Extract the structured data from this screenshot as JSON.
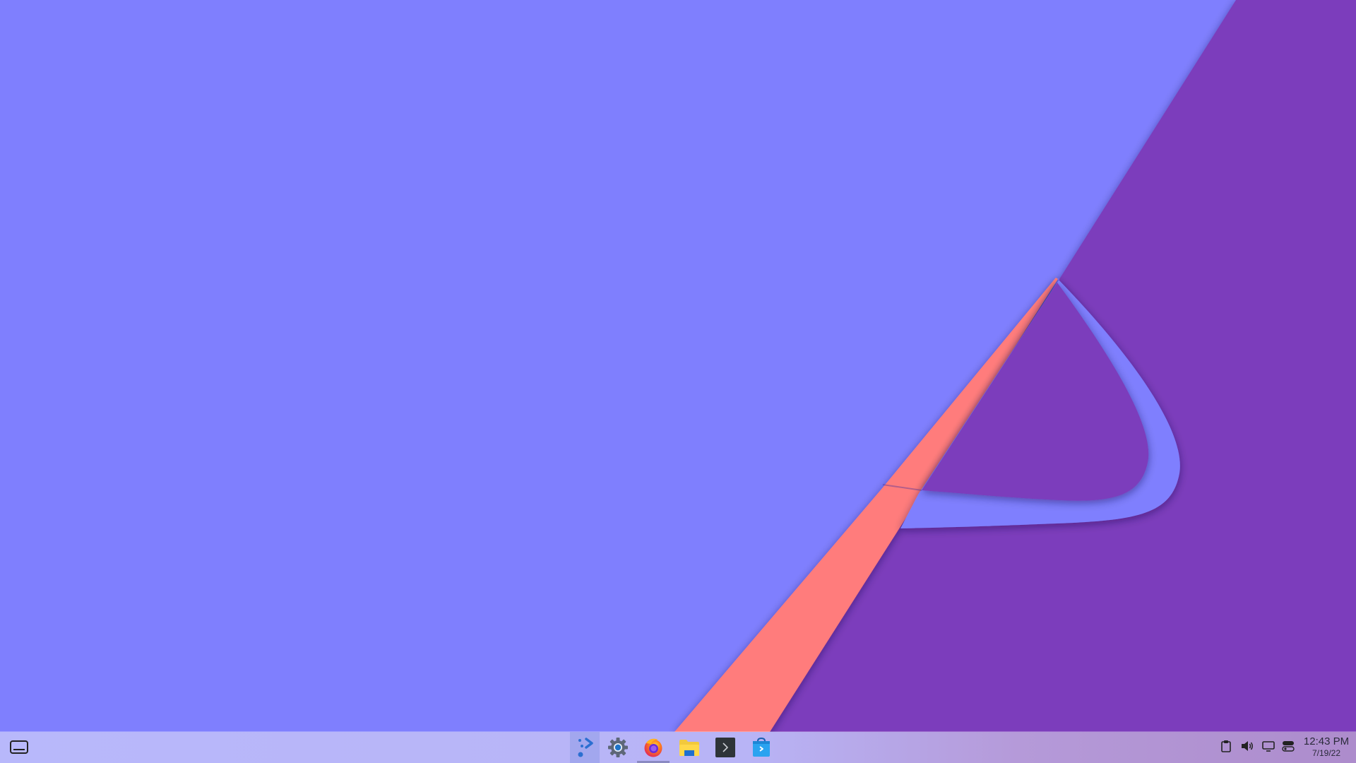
{
  "desktop": {
    "colors": {
      "background": "#7f7ffe",
      "purple": "#7c3cbc",
      "salmon": "#ff7b7b",
      "inner_blue": "#7f7ffe"
    }
  },
  "taskbar": {
    "colors": {
      "panel_left": "#b8b8fb",
      "panel_right": "#ad8ccc",
      "launcher_highlight": "#7f8cdc",
      "active_indicator": "#8a8ac2"
    },
    "show_desktop": {
      "icon": "show-desktop-icon"
    },
    "launcher": {
      "icon": "app-launcher-icon"
    },
    "pinned_apps": [
      {
        "name": "System Settings",
        "icon": "settings-gear-icon",
        "active": false
      },
      {
        "name": "Firefox",
        "icon": "firefox-icon",
        "active": true
      },
      {
        "name": "Files",
        "icon": "folder-icon",
        "active": false
      },
      {
        "name": "Terminal",
        "icon": "terminal-icon",
        "active": false
      },
      {
        "name": "Software Store",
        "icon": "store-bag-icon",
        "active": false
      }
    ],
    "tray": {
      "icons": [
        "clipboard-icon",
        "volume-icon",
        "display-icon",
        "toggle-switch-icon"
      ]
    },
    "clock": {
      "time": "12:43 PM",
      "date": "7/19/22"
    }
  }
}
